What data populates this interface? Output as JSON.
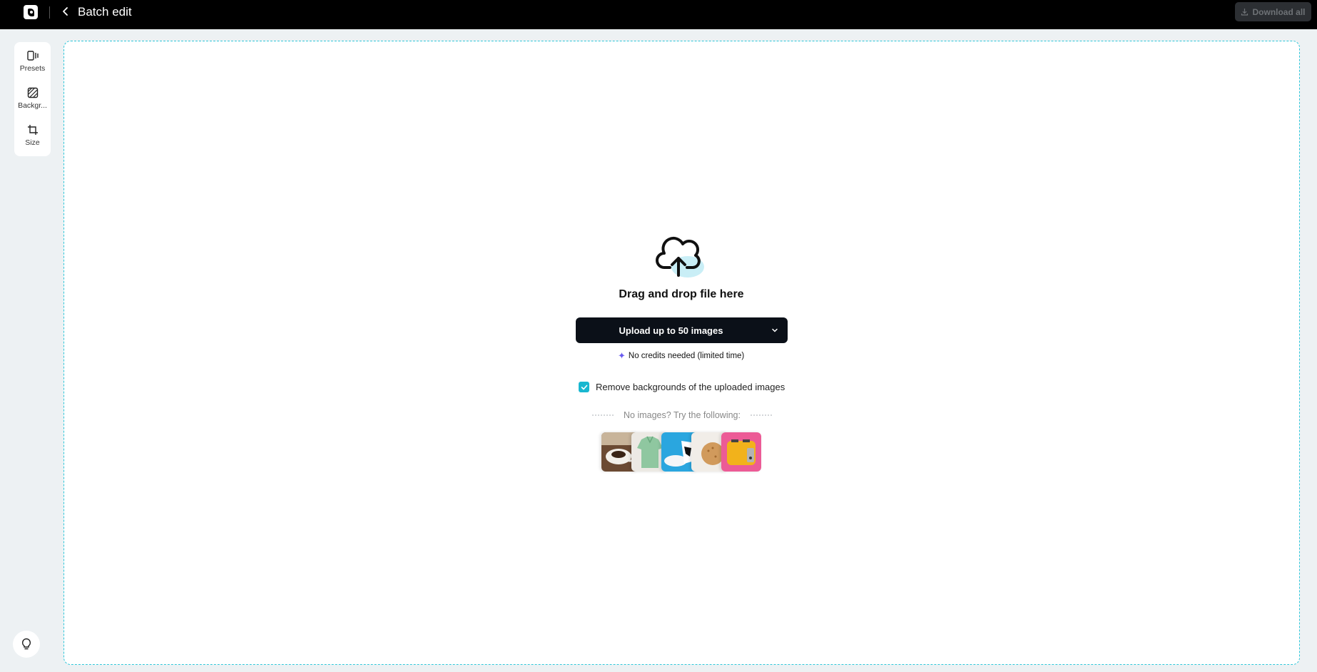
{
  "header": {
    "title": "Batch edit",
    "download_all_label": "Download all"
  },
  "tools": [
    {
      "label": "Presets",
      "icon": "presets-icon"
    },
    {
      "label": "Backgr...",
      "icon": "background-icon"
    },
    {
      "label": "Size",
      "icon": "crop-icon"
    }
  ],
  "dropzone": {
    "heading": "Drag and drop file here",
    "upload_label": "Upload up to 50 images",
    "credits_note": "No credits needed (limited time)",
    "remove_bg_label": "Remove backgrounds of the uploaded images",
    "remove_bg_checked": true,
    "try_label": "No images? Try the following:",
    "samples": [
      "coffee-cup-sample",
      "green-shirt-sample",
      "sneaker-sample",
      "cookies-sample",
      "toaster-sample"
    ]
  },
  "colors": {
    "accent": "#19b7d0",
    "topbar": "#000000",
    "upload_button": "#0b1018",
    "sparkle": "#6a5cf0"
  }
}
